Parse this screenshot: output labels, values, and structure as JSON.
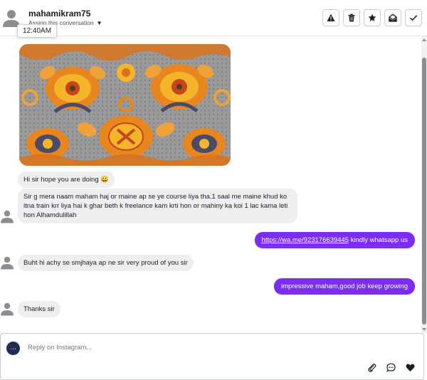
{
  "header": {
    "contact_name": "mahamikram75",
    "assign_label": "Assign this conversation",
    "timestamp_tooltip": "12:40AM",
    "actions": [
      {
        "name": "report-button",
        "icon": "warning-icon"
      },
      {
        "name": "delete-button",
        "icon": "trash-icon"
      },
      {
        "name": "star-button",
        "icon": "star-icon"
      },
      {
        "name": "mark-unread-button",
        "icon": "envelope-open-icon"
      },
      {
        "name": "mark-done-button",
        "icon": "check-icon"
      }
    ]
  },
  "messages": [
    {
      "direction": "incoming",
      "type": "image",
      "alt": "decorative floral embroidery pattern"
    },
    {
      "direction": "incoming",
      "text": "Hi sir hope you are doing 😀"
    },
    {
      "direction": "incoming",
      "text": "Sir g mera naam maham haj or maine ap se ye course liya tha.1 saal me maine  khud ko itna train krr liya hai k ghar beth k freelance kam krti hon or mahiny ka koi 1 lac kama leti hon Alhamdulillah"
    },
    {
      "direction": "outgoing",
      "link": "https://wa.me/923176639445",
      "text": " kindly whatsapp us"
    },
    {
      "direction": "incoming",
      "text": "Buht hi achy se smjhaya ap ne sir very proud of you sir"
    },
    {
      "direction": "outgoing",
      "text": "impressive maham,good job keep growing"
    },
    {
      "direction": "incoming",
      "text": "Thanks sir"
    }
  ],
  "composer": {
    "placeholder": "Reply on Instagram...",
    "icons": [
      "paperclip-icon",
      "chat-bubble-icon",
      "heart-icon"
    ]
  },
  "colors": {
    "outgoing_bubble": "#7b2cf5",
    "incoming_bubble": "#eeeff1",
    "border": "#c9ccd1"
  }
}
